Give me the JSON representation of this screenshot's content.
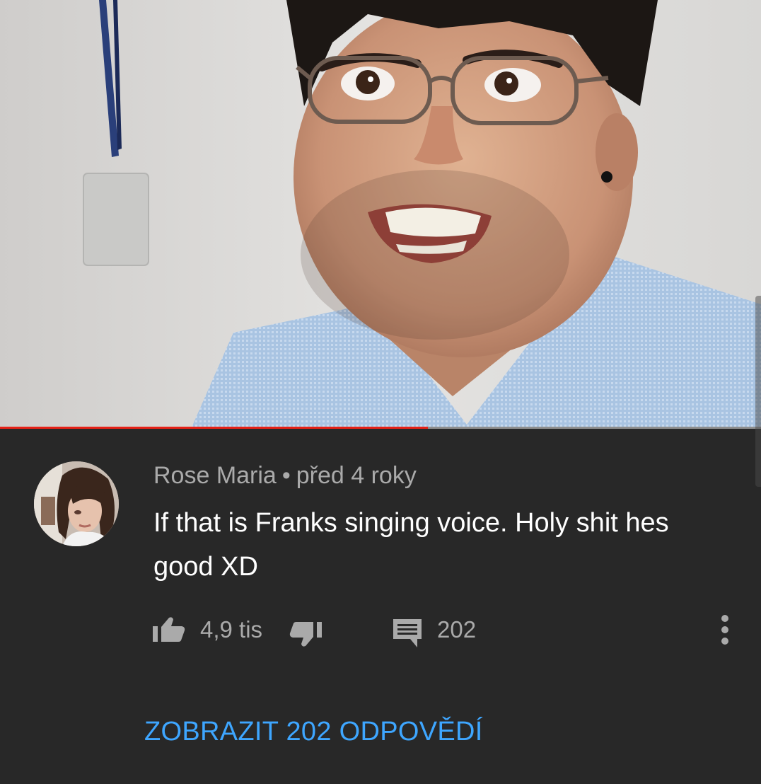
{
  "video": {
    "progress_fraction": 0.562
  },
  "comment": {
    "author": "Rose Maria",
    "separator": "•",
    "time": "před 4 roky",
    "text": "If that is Franks singing voice. Holy shit hes good XD",
    "likes": "4,9 tis",
    "reply_count": "202",
    "view_replies_label": "ZOBRAZIT 202 ODPOVĚDÍ"
  },
  "icons": {
    "like": "thumbs-up-icon",
    "dislike": "thumbs-down-icon",
    "reply": "comment-icon",
    "more": "more-vertical-icon"
  },
  "colors": {
    "background": "#282828",
    "progress": "#e62117",
    "link": "#3ea6ff",
    "secondary_text": "#aaaaaa"
  }
}
